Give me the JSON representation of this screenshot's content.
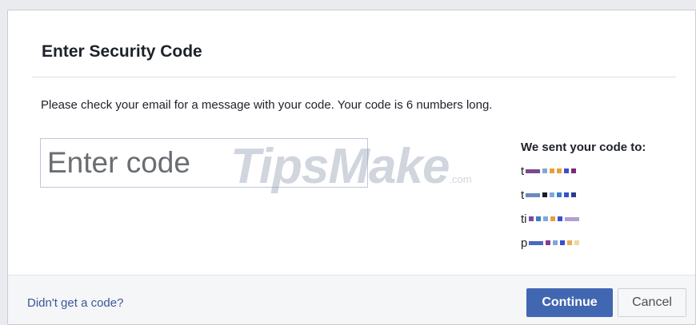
{
  "dialog": {
    "title": "Enter Security Code",
    "message": "Please check your email for a message with your code. Your code is 6 numbers long.",
    "code_input": {
      "placeholder": "Enter code",
      "value": ""
    },
    "watermark": {
      "text": "TipsMake",
      "suffix": ".com"
    },
    "sent_to": {
      "title": "We sent your code to:",
      "recipients": [
        {
          "prefix": "t",
          "redacted": true
        },
        {
          "prefix": "t",
          "redacted": true
        },
        {
          "prefix": "ti",
          "redacted": true
        },
        {
          "prefix": "p",
          "redacted": true
        }
      ]
    },
    "footer": {
      "link_label": "Didn't get a code?",
      "continue_label": "Continue",
      "cancel_label": "Cancel"
    }
  },
  "colors": {
    "primary": "#4267b2",
    "link": "#385898",
    "text": "#1d2129",
    "footer_bg": "#f5f6f7"
  }
}
